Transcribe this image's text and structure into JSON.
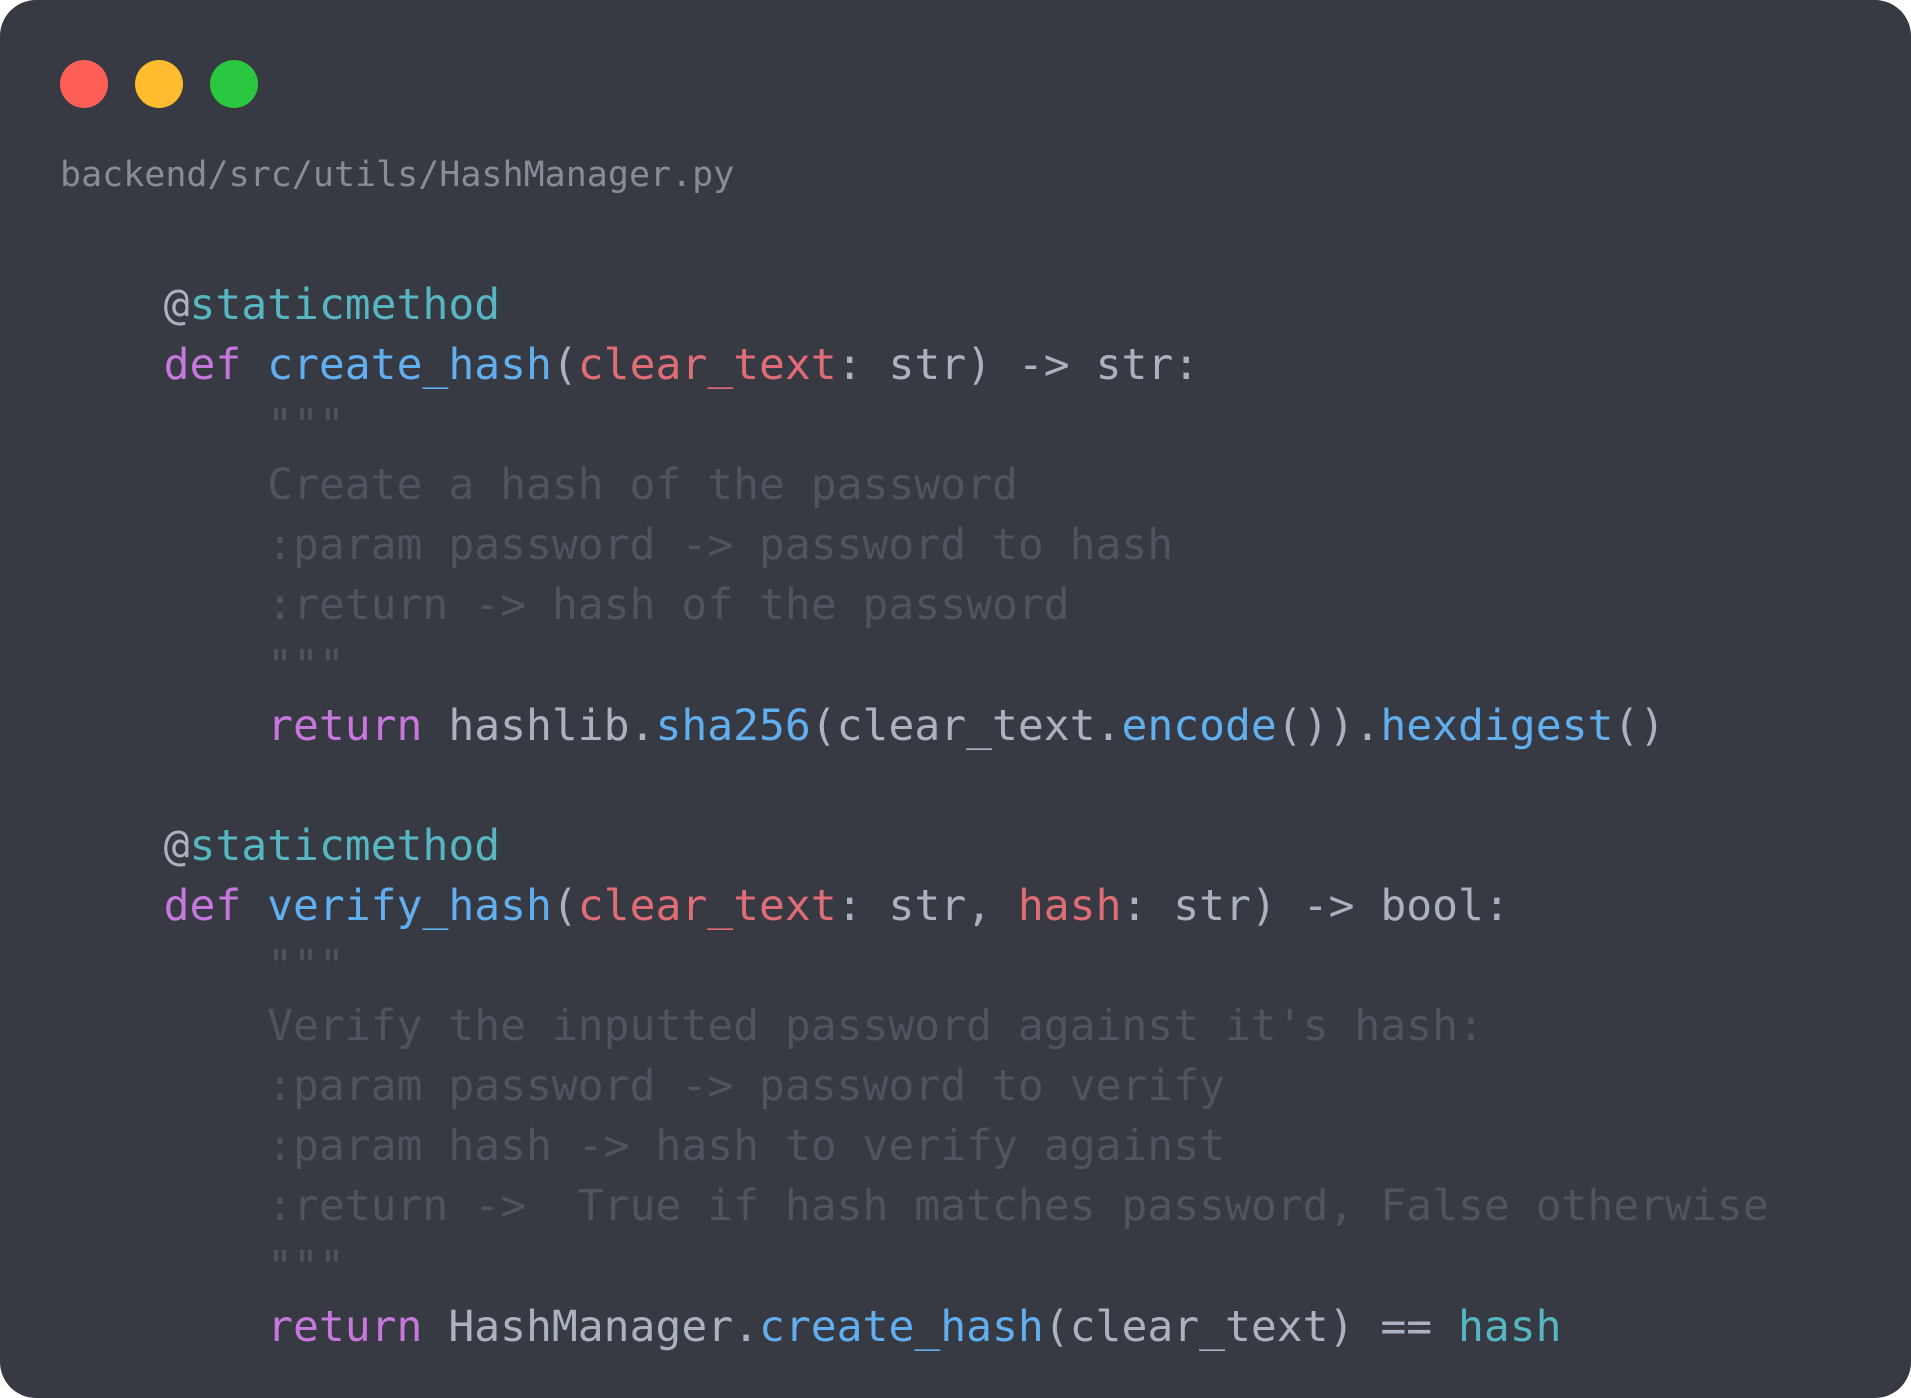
{
  "window": {
    "file_path": "backend/src/utils/HashManager.py",
    "background": "#373a42",
    "controls": [
      {
        "name": "close",
        "color": "#fd5f57"
      },
      {
        "name": "minimize",
        "color": "#febc2e"
      },
      {
        "name": "maximize",
        "color": "#29c840"
      }
    ]
  },
  "palette": {
    "plain": "#abb2bf",
    "keyword": "#c678dd",
    "function": "#61afef",
    "param": "#e06c75",
    "decorator": "#56b6c2",
    "comment": "#5c6370",
    "docstring": "#4f545e"
  },
  "code_lines": [
    [
      {
        "t": "    ",
        "c": "plain"
      },
      {
        "t": "@",
        "c": "plain"
      },
      {
        "t": "staticmethod",
        "c": "decorator"
      }
    ],
    [
      {
        "t": "    ",
        "c": "plain"
      },
      {
        "t": "def ",
        "c": "keyword"
      },
      {
        "t": "create_hash",
        "c": "function"
      },
      {
        "t": "(",
        "c": "plain"
      },
      {
        "t": "clear_text",
        "c": "param"
      },
      {
        "t": ": str) -> str:",
        "c": "plain"
      }
    ],
    [
      {
        "t": "        \"\"\"",
        "c": "docstring"
      }
    ],
    [
      {
        "t": "        Create a hash of the password",
        "c": "docstring"
      }
    ],
    [
      {
        "t": "        :param password -> password to hash",
        "c": "docstring"
      }
    ],
    [
      {
        "t": "        :return -> hash of the password",
        "c": "docstring"
      }
    ],
    [
      {
        "t": "        \"\"\"",
        "c": "docstring"
      }
    ],
    [
      {
        "t": "        ",
        "c": "plain"
      },
      {
        "t": "return ",
        "c": "keyword"
      },
      {
        "t": "hashlib.",
        "c": "plain"
      },
      {
        "t": "sha256",
        "c": "function"
      },
      {
        "t": "(clear_text.",
        "c": "plain"
      },
      {
        "t": "encode",
        "c": "function"
      },
      {
        "t": "()).",
        "c": "plain"
      },
      {
        "t": "hexdigest",
        "c": "function"
      },
      {
        "t": "()",
        "c": "plain"
      }
    ],
    [],
    [
      {
        "t": "    ",
        "c": "plain"
      },
      {
        "t": "@",
        "c": "plain"
      },
      {
        "t": "staticmethod",
        "c": "decorator"
      }
    ],
    [
      {
        "t": "    ",
        "c": "plain"
      },
      {
        "t": "def ",
        "c": "keyword"
      },
      {
        "t": "verify_hash",
        "c": "function"
      },
      {
        "t": "(",
        "c": "plain"
      },
      {
        "t": "clear_text",
        "c": "param"
      },
      {
        "t": ": str, ",
        "c": "plain"
      },
      {
        "t": "hash",
        "c": "param"
      },
      {
        "t": ": str) -> bool:",
        "c": "plain"
      }
    ],
    [
      {
        "t": "        \"\"\"",
        "c": "docstring"
      }
    ],
    [
      {
        "t": "        Verify the inputted password against it's hash:",
        "c": "docstring"
      }
    ],
    [
      {
        "t": "        :param password -> password to verify",
        "c": "docstring"
      }
    ],
    [
      {
        "t": "        :param hash -> hash to verify against",
        "c": "docstring"
      }
    ],
    [
      {
        "t": "        :return ->  True if hash matches password, False otherwise",
        "c": "docstring"
      }
    ],
    [
      {
        "t": "        \"\"\"",
        "c": "docstring"
      }
    ],
    [
      {
        "t": "        ",
        "c": "plain"
      },
      {
        "t": "return ",
        "c": "keyword"
      },
      {
        "t": "HashManager.",
        "c": "plain"
      },
      {
        "t": "create_hash",
        "c": "function"
      },
      {
        "t": "(clear_text) == ",
        "c": "plain"
      },
      {
        "t": "hash",
        "c": "decorator"
      }
    ]
  ]
}
